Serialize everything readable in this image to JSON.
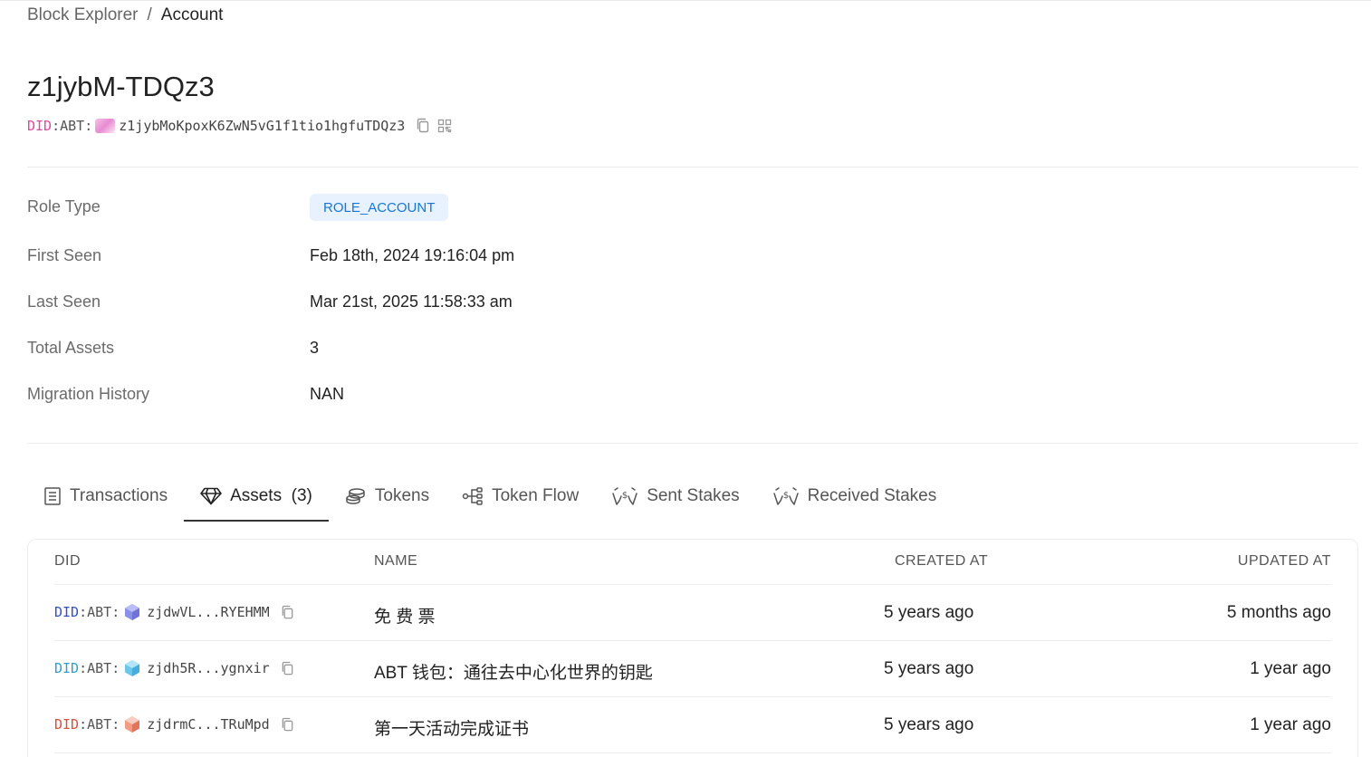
{
  "breadcrumb": {
    "root": "Block Explorer",
    "separator": "/",
    "current": "Account"
  },
  "account": {
    "title": "z1jybM-TDQz3",
    "did_prefix": "DID",
    "did_type": ":ABT:",
    "did_address": "z1jybMoKpoxK6ZwN5vG1f1tio1hgfuTDQz3"
  },
  "info": [
    {
      "label": "Role Type",
      "value": "ROLE_ACCOUNT"
    },
    {
      "label": "First Seen",
      "value": "Feb 18th, 2024 19:16:04 pm"
    },
    {
      "label": "Last Seen",
      "value": "Mar 21st, 2025 11:58:33 am"
    },
    {
      "label": "Total Assets",
      "value": "3"
    },
    {
      "label": "Migration History",
      "value": "NAN"
    }
  ],
  "tabs": [
    {
      "label": "Transactions",
      "icon": "receipt-icon"
    },
    {
      "label": "Assets  (3)",
      "icon": "diamond-icon",
      "active": true
    },
    {
      "label": "Tokens",
      "icon": "coins-icon"
    },
    {
      "label": "Token Flow",
      "icon": "flow-icon"
    },
    {
      "label": "Sent Stakes",
      "icon": "stake-hands-icon"
    },
    {
      "label": "Received Stakes",
      "icon": "stake-hands-icon"
    }
  ],
  "table": {
    "columns": [
      "DID",
      "NAME",
      "CREATED AT",
      "UPDATED AT"
    ],
    "rows": [
      {
        "did_prefix": "DID",
        "did_type": ":ABT:",
        "did_short": "zjdwVL...RYEHMM",
        "prefix_color": "#3350c8",
        "cube_color": "#8a8fe8",
        "name": "免 费 票",
        "created": "5 years ago",
        "updated": "5 months ago"
      },
      {
        "did_prefix": "DID",
        "did_type": ":ABT:",
        "did_short": "zjdh5R...ygnxir",
        "prefix_color": "#2f9ecf",
        "cube_color": "#6ec6ec",
        "name": "ABT 钱包：通往去中心化世界的钥匙",
        "created": "5 years ago",
        "updated": "1 year ago"
      },
      {
        "did_prefix": "DID",
        "did_type": ":ABT:",
        "did_short": "zjdrmC...TRuMpd",
        "prefix_color": "#d9503a",
        "cube_color": "#f29a84",
        "name": "第一天活动完成证书",
        "created": "5 years ago",
        "updated": "1 year ago"
      }
    ]
  }
}
